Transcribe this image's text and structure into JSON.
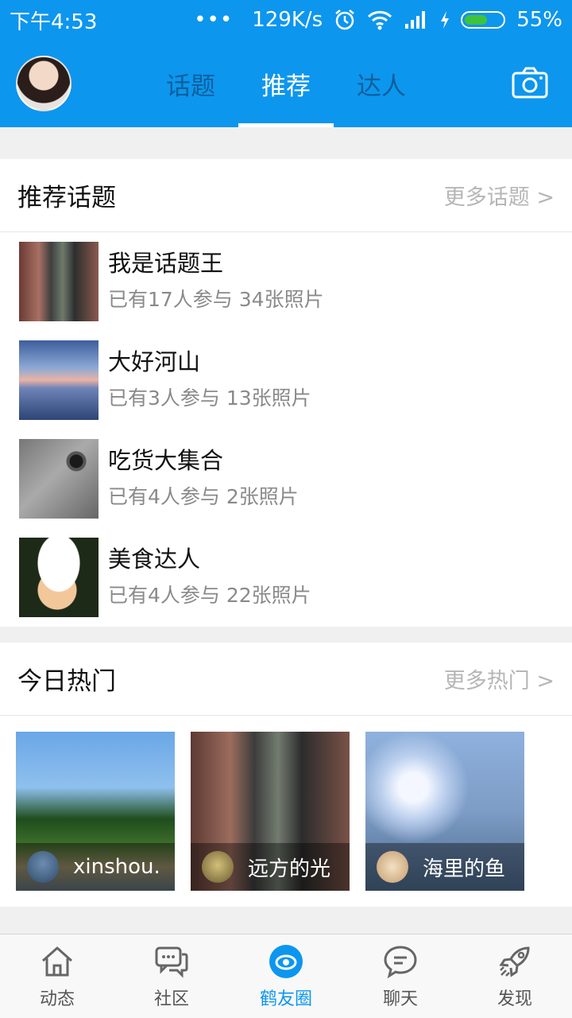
{
  "status_bar": {
    "time": "下午4:53",
    "network_speed": "129K/s",
    "battery": "55%"
  },
  "header": {
    "tabs": [
      {
        "label": "话题"
      },
      {
        "label": "推荐",
        "active": true
      },
      {
        "label": "达人"
      }
    ]
  },
  "recommended": {
    "title": "推荐话题",
    "more": "更多话题 >",
    "items": [
      {
        "name": "我是话题王",
        "meta": "已有17人参与 34张照片"
      },
      {
        "name": "大好河山",
        "meta": "已有3人参与 13张照片"
      },
      {
        "name": "吃货大集合",
        "meta": "已有4人参与 2张照片"
      },
      {
        "name": "美食达人",
        "meta": "已有4人参与 22张照片"
      }
    ]
  },
  "hot": {
    "title": "今日热门",
    "more": "更多热门 >",
    "cards": [
      {
        "user": "xinshou."
      },
      {
        "user": "远方的光"
      },
      {
        "user": "海里的鱼"
      }
    ]
  },
  "bottom_nav": [
    {
      "label": "动态",
      "icon": "home-icon"
    },
    {
      "label": "社区",
      "icon": "community-chat-icon"
    },
    {
      "label": "鹤友圈",
      "icon": "eye-circle-icon",
      "active": true
    },
    {
      "label": "聊天",
      "icon": "chat-bubble-icon"
    },
    {
      "label": "发现",
      "icon": "rocket-icon"
    }
  ],
  "colors": {
    "primary": "#0d96ee",
    "active_tab_text": "#ffffff",
    "muted_text": "#8a8a8a"
  }
}
